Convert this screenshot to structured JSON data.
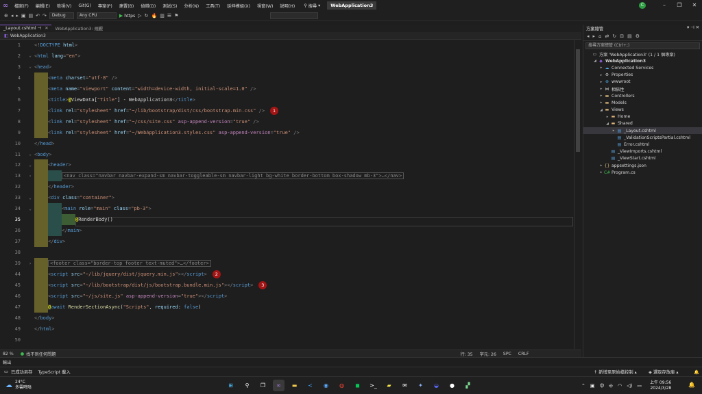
{
  "menubar": {
    "items": [
      "檔案(F)",
      "編輯(E)",
      "檢視(V)",
      "Git(G)",
      "專案(P)",
      "建置(B)",
      "偵錯(D)",
      "測試(S)",
      "分析(N)",
      "工具(T)",
      "延伸模組(X)",
      "視窗(W)",
      "說明(H)"
    ],
    "search_label": "搜尋",
    "solution_title": "WebApplication3",
    "user_initial": "C"
  },
  "toolbar": {
    "config": "Debug",
    "platform": "Any CPU",
    "run_profile": "https"
  },
  "tabs": [
    {
      "label": "_Layout.cshtml"
    },
    {
      "label": "WebApplication3: 規觀"
    }
  ],
  "navbar": {
    "project": "WebApplication3"
  },
  "editor": {
    "status": {
      "zoom": "82 %",
      "issues": "找不到任何問題",
      "line": "行: 35",
      "col": "字元: 26",
      "spc": "SPC",
      "eol": "CRLF"
    }
  },
  "output_panel": {
    "title": "輸出"
  },
  "solution_explorer": {
    "title": "方案總管",
    "search_placeholder": "搜尋方案總管 (Ctrl+;)",
    "tree": [
      "方案 'WebApplication3' (1 / 1 個專案)",
      "WebApplication3",
      "Connected Services",
      "Properties",
      "wwwroot",
      "相依性",
      "Controllers",
      "Models",
      "Views",
      "Home",
      "Shared",
      "_Layout.cshtml",
      "_ValidationScriptsPartial.cshtml",
      "Error.cshtml",
      "_ViewImports.cshtml",
      "_ViewStart.cshtml",
      "appsettings.json",
      "Program.cs"
    ]
  },
  "statusbar": {
    "ready": "已成功另存",
    "language": "TypeScript 載入",
    "git_action": "新增至原始檔控制",
    "repo_action": "選取存放庫"
  },
  "taskbar": {
    "temperature": "24°C",
    "weather": "多雲時陰",
    "ime": "中",
    "time": "上午 09:56",
    "date": "2024/3/28"
  },
  "code_lines": [
    {
      "n": "1",
      "parts": [
        [
          "p",
          "<!"
        ],
        [
          "t",
          "DOCTYPE"
        ],
        [
          "a",
          " html"
        ],
        [
          "p",
          ">"
        ]
      ]
    },
    {
      "n": "2",
      "parts": [
        [
          "p",
          "<"
        ],
        [
          "t",
          "html"
        ],
        [
          "a",
          " lang"
        ],
        [
          "p",
          "="
        ],
        [
          "s",
          "\"en\""
        ],
        [
          "p",
          ">"
        ]
      ]
    },
    {
      "n": "3",
      "parts": [
        [
          "p",
          "<"
        ],
        [
          "t",
          "head"
        ],
        [
          "p",
          ">"
        ]
      ]
    },
    {
      "n": "4",
      "parts": [
        [
          "p",
          "<"
        ],
        [
          "t",
          "meta"
        ],
        [
          "a",
          " charset"
        ],
        [
          "p",
          "="
        ],
        [
          "s",
          "\"utf-8\""
        ],
        [
          "p",
          " />"
        ]
      ]
    },
    {
      "n": "5",
      "parts": [
        [
          "p",
          "<"
        ],
        [
          "t",
          "meta"
        ],
        [
          "a",
          " name"
        ],
        [
          "p",
          "="
        ],
        [
          "s",
          "\"viewport\""
        ],
        [
          "a",
          " content"
        ],
        [
          "p",
          "="
        ],
        [
          "s",
          "\"width=device-width, initial-scale=1.0\""
        ],
        [
          "p",
          " />"
        ]
      ]
    },
    {
      "n": "6",
      "parts": [
        [
          "p",
          "<"
        ],
        [
          "t",
          "title"
        ],
        [
          "p",
          ">"
        ],
        [
          "rz",
          "@"
        ],
        [
          "tx",
          "ViewData["
        ],
        [
          "s",
          "\"Title\""
        ],
        [
          "tx",
          "] - WebApplication3"
        ],
        [
          "p",
          "</"
        ],
        [
          "t",
          "title"
        ],
        [
          "p",
          ">"
        ]
      ]
    },
    {
      "n": "7",
      "parts": [
        [
          "p",
          "<"
        ],
        [
          "t",
          "link"
        ],
        [
          "a",
          " rel"
        ],
        [
          "p",
          "="
        ],
        [
          "s",
          "\"stylesheet\""
        ],
        [
          "a",
          " href"
        ],
        [
          "p",
          "="
        ],
        [
          "s",
          "\"~/lib/bootstrap/dist/css/bootstrap.min.css\""
        ],
        [
          "p",
          " />"
        ]
      ],
      "badge": "1"
    },
    {
      "n": "8",
      "parts": [
        [
          "p",
          "<"
        ],
        [
          "t",
          "link"
        ],
        [
          "a",
          " rel"
        ],
        [
          "p",
          "="
        ],
        [
          "s",
          "\"stylesheet\""
        ],
        [
          "a",
          " href"
        ],
        [
          "p",
          "="
        ],
        [
          "s",
          "\"~/css/site.css\""
        ],
        [
          "ctl",
          " asp-append-version"
        ],
        [
          "p",
          "="
        ],
        [
          "s",
          "\"true\""
        ],
        [
          "p",
          " />"
        ]
      ]
    },
    {
      "n": "9",
      "parts": [
        [
          "p",
          "<"
        ],
        [
          "t",
          "link"
        ],
        [
          "a",
          " rel"
        ],
        [
          "p",
          "="
        ],
        [
          "s",
          "\"stylesheet\""
        ],
        [
          "a",
          " href"
        ],
        [
          "p",
          "="
        ],
        [
          "s",
          "\"~/WebApplication3.styles.css\""
        ],
        [
          "ctl",
          " asp-append-version"
        ],
        [
          "p",
          "="
        ],
        [
          "s",
          "\"true\""
        ],
        [
          "p",
          " />"
        ]
      ]
    },
    {
      "n": "10",
      "parts": [
        [
          "p",
          "</"
        ],
        [
          "t",
          "head"
        ],
        [
          "p",
          ">"
        ]
      ]
    },
    {
      "n": "11",
      "parts": [
        [
          "p",
          "<"
        ],
        [
          "t",
          "body"
        ],
        [
          "p",
          ">"
        ]
      ]
    },
    {
      "n": "12",
      "parts": [
        [
          "p",
          "<"
        ],
        [
          "t",
          "header"
        ],
        [
          "p",
          ">"
        ]
      ]
    },
    {
      "n": "13",
      "collapsed": "<nav class=\"navbar navbar-expand-sm navbar-toggleable-sm navbar-light bg-white border-bottom box-shadow mb-3\">…</nav>"
    },
    {
      "n": "32",
      "parts": [
        [
          "p",
          "</"
        ],
        [
          "t",
          "header"
        ],
        [
          "p",
          ">"
        ]
      ]
    },
    {
      "n": "33",
      "parts": [
        [
          "p",
          "<"
        ],
        [
          "t",
          "div"
        ],
        [
          "a",
          " class"
        ],
        [
          "p",
          "="
        ],
        [
          "s",
          "\"container\""
        ],
        [
          "p",
          ">"
        ]
      ]
    },
    {
      "n": "34",
      "parts": [
        [
          "p",
          "<"
        ],
        [
          "t",
          "main"
        ],
        [
          "a",
          " role"
        ],
        [
          "p",
          "="
        ],
        [
          "s",
          "\"main\""
        ],
        [
          "a",
          " class"
        ],
        [
          "p",
          "="
        ],
        [
          "s",
          "\"pb-3\""
        ],
        [
          "p",
          ">"
        ]
      ]
    },
    {
      "n": "35",
      "parts": [
        [
          "rz",
          "@"
        ],
        [
          "tx",
          "RenderBody()"
        ]
      ]
    },
    {
      "n": "36",
      "parts": [
        [
          "p",
          "</"
        ],
        [
          "t",
          "main"
        ],
        [
          "p",
          ">"
        ]
      ]
    },
    {
      "n": "37",
      "parts": [
        [
          "p",
          "</"
        ],
        [
          "t",
          "div"
        ],
        [
          "p",
          ">"
        ]
      ]
    },
    {
      "n": "38",
      "parts": []
    },
    {
      "n": "39",
      "collapsed": "<footer class=\"border-top footer text-muted\">…</footer>"
    },
    {
      "n": "44",
      "parts": [
        [
          "p",
          "<"
        ],
        [
          "t",
          "script"
        ],
        [
          "a",
          " src"
        ],
        [
          "p",
          "="
        ],
        [
          "s",
          "\"~/lib/jquery/dist/jquery.min.js\""
        ],
        [
          "p",
          "></"
        ],
        [
          "t",
          "script"
        ],
        [
          "p",
          ">"
        ]
      ],
      "badge": "2"
    },
    {
      "n": "45",
      "parts": [
        [
          "p",
          "<"
        ],
        [
          "t",
          "script"
        ],
        [
          "a",
          " src"
        ],
        [
          "p",
          "="
        ],
        [
          "s",
          "\"~/lib/bootstrap/dist/js/bootstrap.bundle.min.js\""
        ],
        [
          "p",
          "></"
        ],
        [
          "t",
          "script"
        ],
        [
          "p",
          ">"
        ]
      ],
      "badge": "3"
    },
    {
      "n": "46",
      "parts": [
        [
          "p",
          "<"
        ],
        [
          "t",
          "script"
        ],
        [
          "a",
          " src"
        ],
        [
          "p",
          "="
        ],
        [
          "s",
          "\"~/js/site.js\""
        ],
        [
          "ctl",
          " asp-append-version"
        ],
        [
          "p",
          "="
        ],
        [
          "s",
          "\"true\""
        ],
        [
          "p",
          "></"
        ],
        [
          "t",
          "script"
        ],
        [
          "p",
          ">"
        ]
      ]
    },
    {
      "n": "47",
      "parts": [
        [
          "rz",
          "@"
        ],
        [
          "t",
          "await"
        ],
        [
          "fn",
          " RenderSectionAsync"
        ],
        [
          "tx",
          "("
        ],
        [
          "s",
          "\"Scripts\""
        ],
        [
          "tx",
          ", "
        ],
        [
          "a",
          "required"
        ],
        [
          "tx",
          ": "
        ],
        [
          "t",
          "false"
        ],
        [
          "tx",
          ")"
        ]
      ]
    },
    {
      "n": "48",
      "parts": [
        [
          "p",
          "</"
        ],
        [
          "t",
          "body"
        ],
        [
          "p",
          ">"
        ]
      ]
    },
    {
      "n": "49",
      "parts": [
        [
          "p",
          "</"
        ],
        [
          "t",
          "html"
        ],
        [
          "p",
          ">"
        ]
      ]
    },
    {
      "n": "50",
      "parts": []
    }
  ]
}
